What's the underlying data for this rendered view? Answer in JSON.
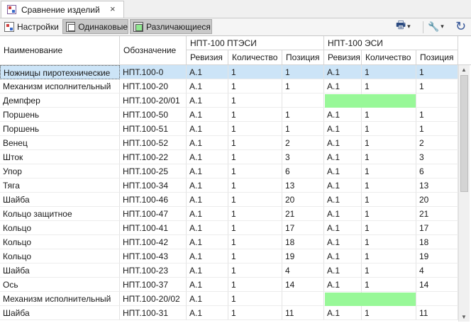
{
  "tab": {
    "title": "Сравнение изделий",
    "close": "×"
  },
  "toolbar": {
    "settings": "Настройки",
    "same": "Одинаковые",
    "diff": "Различающиеся",
    "print_icon": "🖶",
    "caret": "▾",
    "wrench_icon": "🔧",
    "refresh_icon": "↻"
  },
  "columns": {
    "name": "Наименование",
    "designation": "Обозначение",
    "group_a": "НПТ-100 ПТЭСИ",
    "group_b": "НПТ-100 ЭСИ",
    "revision": "Ревизия",
    "quantity": "Количество",
    "position": "Позиция"
  },
  "rows": [
    {
      "name": "Ножницы пиротехнические",
      "code": "НПТ.100-0",
      "a_rev": "А.1",
      "a_qty": "1",
      "a_pos": "1",
      "b_rev": "А.1",
      "b_qty": "1",
      "b_pos": "1",
      "selected": true
    },
    {
      "name": "Механизм исполнительный",
      "code": "НПТ.100-20",
      "a_rev": "А.1",
      "a_qty": "1",
      "a_pos": "1",
      "b_rev": "А.1",
      "b_qty": "1",
      "b_pos": "1"
    },
    {
      "name": "Демпфер",
      "code": "НПТ.100-20/01",
      "a_rev": "А.1",
      "a_qty": "1",
      "a_pos": "",
      "b_rev": "",
      "b_qty": "",
      "b_pos": "",
      "missing": true
    },
    {
      "name": "Поршень",
      "code": "НПТ.100-50",
      "a_rev": "А.1",
      "a_qty": "1",
      "a_pos": "1",
      "b_rev": "А.1",
      "b_qty": "1",
      "b_pos": "1"
    },
    {
      "name": "Поршень",
      "code": "НПТ.100-51",
      "a_rev": "А.1",
      "a_qty": "1",
      "a_pos": "1",
      "b_rev": "А.1",
      "b_qty": "1",
      "b_pos": "1"
    },
    {
      "name": "Венец",
      "code": "НПТ.100-52",
      "a_rev": "А.1",
      "a_qty": "1",
      "a_pos": "2",
      "b_rev": "А.1",
      "b_qty": "1",
      "b_pos": "2"
    },
    {
      "name": "Шток",
      "code": "НПТ.100-22",
      "a_rev": "А.1",
      "a_qty": "1",
      "a_pos": "3",
      "b_rev": "А.1",
      "b_qty": "1",
      "b_pos": "3"
    },
    {
      "name": "Упор",
      "code": "НПТ.100-25",
      "a_rev": "А.1",
      "a_qty": "1",
      "a_pos": "6",
      "b_rev": "А.1",
      "b_qty": "1",
      "b_pos": "6"
    },
    {
      "name": "Тяга",
      "code": "НПТ.100-34",
      "a_rev": "А.1",
      "a_qty": "1",
      "a_pos": "13",
      "b_rev": "А.1",
      "b_qty": "1",
      "b_pos": "13"
    },
    {
      "name": "Шайба",
      "code": "НПТ.100-46",
      "a_rev": "А.1",
      "a_qty": "1",
      "a_pos": "20",
      "b_rev": "А.1",
      "b_qty": "1",
      "b_pos": "20"
    },
    {
      "name": "Кольцо защитное",
      "code": "НПТ.100-47",
      "a_rev": "А.1",
      "a_qty": "1",
      "a_pos": "21",
      "b_rev": "А.1",
      "b_qty": "1",
      "b_pos": "21"
    },
    {
      "name": "Кольцо",
      "code": "НПТ.100-41",
      "a_rev": "А.1",
      "a_qty": "1",
      "a_pos": "17",
      "b_rev": "А.1",
      "b_qty": "1",
      "b_pos": "17"
    },
    {
      "name": "Кольцо",
      "code": "НПТ.100-42",
      "a_rev": "А.1",
      "a_qty": "1",
      "a_pos": "18",
      "b_rev": "А.1",
      "b_qty": "1",
      "b_pos": "18"
    },
    {
      "name": "Кольцо",
      "code": "НПТ.100-43",
      "a_rev": "А.1",
      "a_qty": "1",
      "a_pos": "19",
      "b_rev": "А.1",
      "b_qty": "1",
      "b_pos": "19"
    },
    {
      "name": "Шайба",
      "code": "НПТ.100-23",
      "a_rev": "А.1",
      "a_qty": "1",
      "a_pos": "4",
      "b_rev": "А.1",
      "b_qty": "1",
      "b_pos": "4"
    },
    {
      "name": "Ось",
      "code": "НПТ.100-37",
      "a_rev": "А.1",
      "a_qty": "1",
      "a_pos": "14",
      "b_rev": "А.1",
      "b_qty": "1",
      "b_pos": "14"
    },
    {
      "name": "Механизм исполнительный",
      "code": "НПТ.100-20/02",
      "a_rev": "А.1",
      "a_qty": "1",
      "a_pos": "",
      "b_rev": "",
      "b_qty": "",
      "b_pos": "",
      "missing": true
    },
    {
      "name": "Шайба",
      "code": "НПТ.100-31",
      "a_rev": "А.1",
      "a_qty": "1",
      "a_pos": "11",
      "b_rev": "А.1",
      "b_qty": "1",
      "b_pos": "11"
    }
  ],
  "colors": {
    "selection": "#cce4f7",
    "missing": "#98f898"
  },
  "scrollbar": {
    "up": "▲",
    "down": "▼"
  }
}
